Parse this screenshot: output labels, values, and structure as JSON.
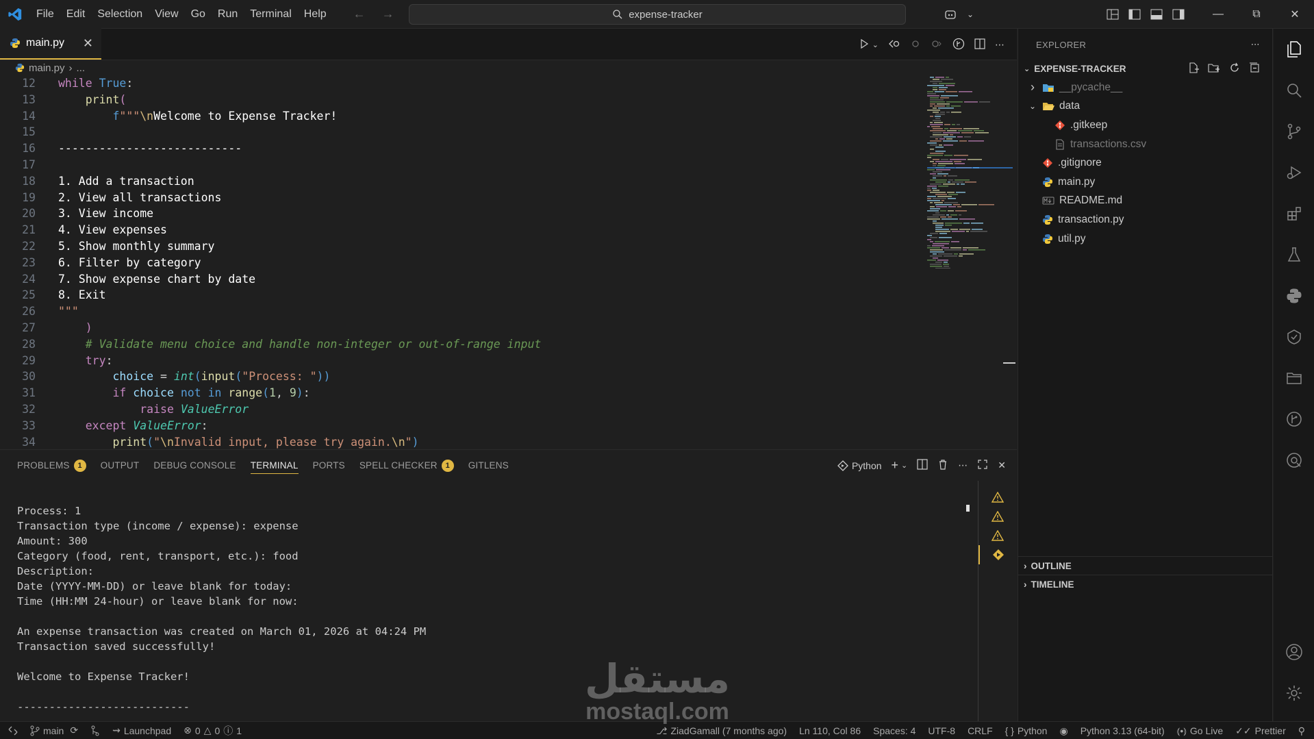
{
  "titlebar": {
    "menu": [
      "File",
      "Edit",
      "Selection",
      "View",
      "Go",
      "Run",
      "Terminal",
      "Help"
    ],
    "search_text": "expense-tracker"
  },
  "editor": {
    "tab_label": "main.py",
    "breadcrumb_file": "main.py",
    "breadcrumb_rest": "...",
    "lines": [
      {
        "n": "12",
        "html": "<span class='kw'>while</span> <span class='kw2'>True</span><span class='op'>:</span>"
      },
      {
        "n": "13",
        "html": "    <span class='fn'>print</span><span class='kw'>(</span>"
      },
      {
        "n": "14",
        "html": "        <span class='kw2'>f</span><span class='str'>\"\"\"</span><span class='esc'>\\n</span><span class='menutext'>Welcome to Expense Tracker!</span>"
      },
      {
        "n": "15",
        "html": ""
      },
      {
        "n": "16",
        "html": "<span class='menutext'>---------------------------</span>"
      },
      {
        "n": "17",
        "html": ""
      },
      {
        "n": "18",
        "html": "<span class='menutext'>1. Add a transaction</span>"
      },
      {
        "n": "19",
        "html": "<span class='menutext'>2. View all transactions</span>"
      },
      {
        "n": "20",
        "html": "<span class='menutext'>3. View income</span>"
      },
      {
        "n": "21",
        "html": "<span class='menutext'>4. View expenses</span>"
      },
      {
        "n": "22",
        "html": "<span class='menutext'>5. Show monthly summary</span>"
      },
      {
        "n": "23",
        "html": "<span class='menutext'>6. Filter by category</span>"
      },
      {
        "n": "24",
        "html": "<span class='menutext'>7. Show expense chart by date</span>"
      },
      {
        "n": "25",
        "html": "<span class='menutext'>8. Exit</span>"
      },
      {
        "n": "26",
        "html": "<span class='str'>\"\"\"</span>"
      },
      {
        "n": "27",
        "html": "    <span class='kw'>)</span>"
      },
      {
        "n": "28",
        "html": "    <span class='cm'># Validate menu choice and handle non-integer or out-of-range input</span>"
      },
      {
        "n": "29",
        "html": "    <span class='kw'>try</span><span class='op'>:</span>"
      },
      {
        "n": "30",
        "html": "        <span class='var'>choice</span> <span class='op'>=</span> <span class='cls'>int</span><span class='kw2'>(</span><span class='fn'>input</span><span class='kw2'>(</span><span class='str'>\"Process: \"</span><span class='kw2'>))</span>"
      },
      {
        "n": "31",
        "html": "        <span class='kw'>if</span> <span class='var'>choice</span> <span class='kw2'>not in</span> <span class='fn'>range</span><span class='kw2'>(</span><span class='num'>1</span>, <span class='num'>9</span><span class='kw2'>)</span><span class='op'>:</span>"
      },
      {
        "n": "32",
        "html": "            <span class='kw'>raise</span> <span class='cls'>ValueError</span>"
      },
      {
        "n": "33",
        "html": "    <span class='kw'>except</span> <span class='cls'>ValueError</span><span class='op'>:</span>"
      },
      {
        "n": "34",
        "html": "        <span class='fn'>print</span><span class='kw2'>(</span><span class='str'>\"</span><span class='esc'>\\n</span><span class='str'>Invalid input, please try again.</span><span class='esc'>\\n</span><span class='str'>\"</span><span class='kw2'>)</span>"
      }
    ]
  },
  "panel": {
    "tabs": [
      {
        "label": "PROBLEMS",
        "badge": "1"
      },
      {
        "label": "OUTPUT",
        "badge": ""
      },
      {
        "label": "DEBUG CONSOLE",
        "badge": ""
      },
      {
        "label": "TERMINAL",
        "badge": "",
        "active": true
      },
      {
        "label": "PORTS",
        "badge": ""
      },
      {
        "label": "SPELL CHECKER",
        "badge": "1"
      },
      {
        "label": "GITLENS",
        "badge": ""
      }
    ],
    "shell_label": "Python",
    "terminal_lines": [
      "",
      "Process: 1",
      "Transaction type (income / expense): expense",
      "Amount: 300",
      "Category (food, rent, transport, etc.): food",
      "Description:",
      "Date (YYYY-MM-DD) or leave blank for today:",
      "Time (HH:MM 24-hour) or leave blank for now:",
      "",
      "An expense transaction was created on March 01, 2026 at 04:24 PM",
      "Transaction saved successfully!",
      "",
      "Welcome to Expense Tracker!",
      "",
      "---------------------------"
    ]
  },
  "explorer": {
    "title": "EXPLORER",
    "project": "EXPENSE-TRACKER",
    "items": [
      {
        "label": "__pycache__",
        "depth": 0,
        "kind": "folder-closed",
        "dim": true
      },
      {
        "label": "data",
        "depth": 0,
        "kind": "folder-open",
        "dim": false
      },
      {
        "label": ".gitkeep",
        "depth": 1,
        "kind": "git",
        "dim": false
      },
      {
        "label": "transactions.csv",
        "depth": 1,
        "kind": "csv",
        "dim": true
      },
      {
        "label": ".gitignore",
        "depth": 0,
        "kind": "git",
        "dim": false
      },
      {
        "label": "main.py",
        "depth": 0,
        "kind": "python",
        "dim": false
      },
      {
        "label": "README.md",
        "depth": 0,
        "kind": "markdown",
        "dim": false
      },
      {
        "label": "transaction.py",
        "depth": 0,
        "kind": "python",
        "dim": false
      },
      {
        "label": "util.py",
        "depth": 0,
        "kind": "python",
        "dim": false
      }
    ],
    "outline": "OUTLINE",
    "timeline": "TIMELINE"
  },
  "statusbar": {
    "branch": "main",
    "launchpad": "Launchpad",
    "errors": "0",
    "warnings": "0",
    "info": "1",
    "blame": "ZiadGamall (7 months ago)",
    "position": "Ln 110, Col 86",
    "spaces": "Spaces: 4",
    "encoding": "UTF-8",
    "eol": "CRLF",
    "language": "Python",
    "interpreter": "Python 3.13 (64-bit)",
    "golive": "Go Live",
    "prettier": "Prettier"
  },
  "watermark": {
    "arabic": "مستقل",
    "latin": "mostaql.com"
  },
  "colors": {
    "accent": "#e0b743",
    "background": "#1f1f1f",
    "sidebar": "#181818"
  }
}
